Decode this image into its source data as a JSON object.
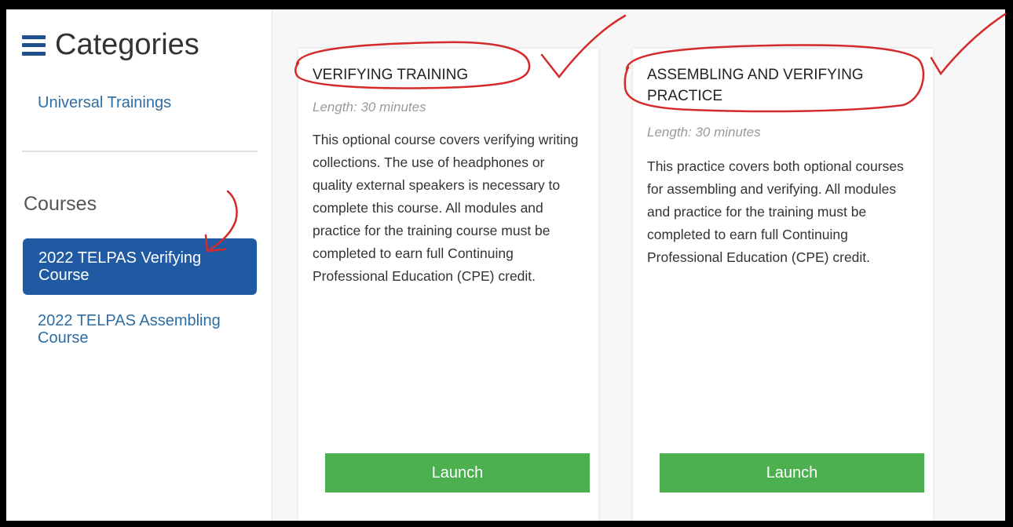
{
  "sidebar": {
    "categories_title": "Categories",
    "category_items": [
      "Universal Trainings"
    ],
    "courses_title": "Courses",
    "course_items": [
      {
        "label": "2022 TELPAS Verifying Course",
        "active": true
      },
      {
        "label": "2022 TELPAS Assembling Course",
        "active": false
      }
    ]
  },
  "cards": [
    {
      "title": "VERIFYING TRAINING",
      "length": "Length: 30 minutes",
      "description": "This optional course covers verifying writing collections. The use of headphones or quality external speakers is necessary to complete this course. All modules and practice for the training course must be completed to earn full Continuing Professional Education (CPE) credit.",
      "button": "Launch"
    },
    {
      "title": "ASSEMBLING AND VERIFYING PRACTICE",
      "length": "Length: 30 minutes",
      "description": "This practice covers both optional courses for assembling and verifying. All modules and practice for the training must be completed to earn full Continuing Professional Education (CPE) credit.",
      "button": "Launch"
    }
  ],
  "colors": {
    "active_course_bg": "#1f5aa3",
    "link": "#2e6da4",
    "launch_button": "#4caf50",
    "annotation": "#d42a2a"
  }
}
